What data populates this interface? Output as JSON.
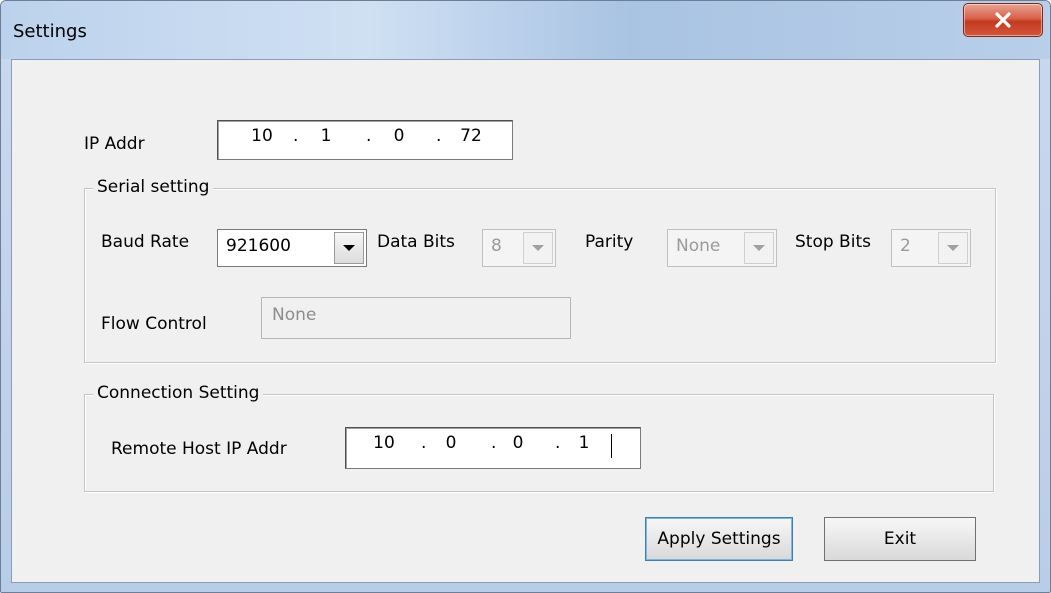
{
  "window": {
    "title": "Settings"
  },
  "ip_addr": {
    "label": "IP Addr",
    "octets": [
      "10",
      "1",
      "0",
      "72"
    ]
  },
  "serial": {
    "group_title": "Serial setting",
    "baud_rate": {
      "label": "Baud Rate",
      "value": "921600"
    },
    "data_bits": {
      "label": "Data Bits",
      "value": "8"
    },
    "parity": {
      "label": "Parity",
      "value": "None"
    },
    "stop_bits": {
      "label": "Stop Bits",
      "value": "2"
    },
    "flow_control": {
      "label": "Flow Control",
      "value": "None"
    }
  },
  "connection": {
    "group_title": "Connection Setting",
    "remote_host": {
      "label": "Remote Host IP Addr",
      "octets": [
        "10",
        "0",
        "0",
        "1"
      ]
    }
  },
  "buttons": {
    "apply": "Apply Settings",
    "exit": "Exit"
  },
  "icons": {
    "close": "close-icon",
    "dropdown": "chevron-down-icon"
  },
  "colors": {
    "close_button": "#c9442a",
    "client_bg": "#f0f0f0"
  }
}
